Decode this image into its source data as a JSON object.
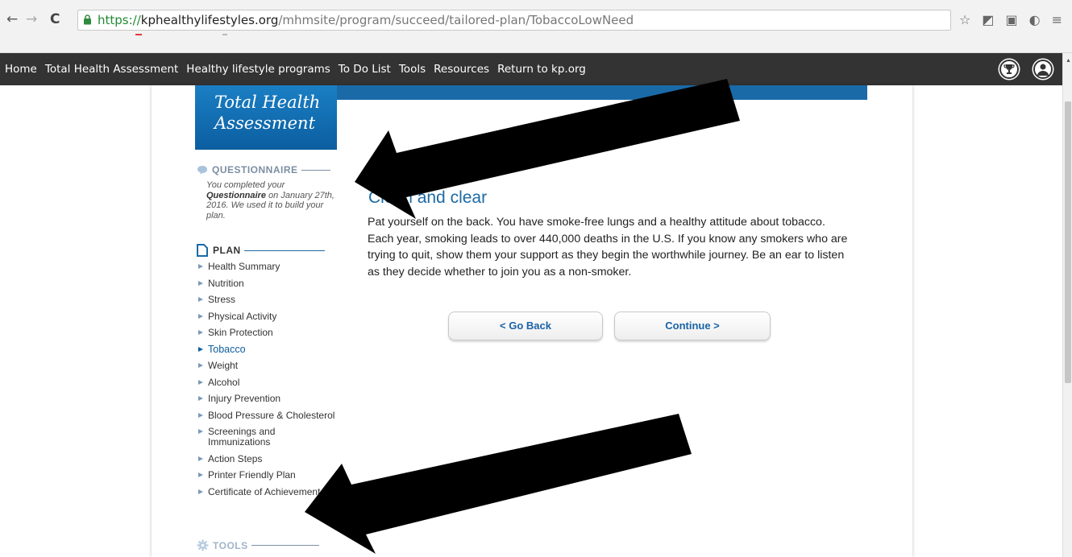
{
  "browser": {
    "url_scheme": "https://",
    "url_host": "kphealthylifestyles.org",
    "url_path": "/mhmsite/program/succeed/tailored-plan/TobaccoLowNeed",
    "back_glyph": "←",
    "forward_glyph": "→",
    "reload_glyph": "C"
  },
  "site_nav": {
    "items": [
      {
        "label": "Home"
      },
      {
        "label": "Total Health Assessment"
      },
      {
        "label": "Healthy lifestyle programs"
      },
      {
        "label": "To Do List"
      },
      {
        "label": "Tools"
      },
      {
        "label": "Resources"
      },
      {
        "label": "Return to kp.org"
      }
    ],
    "right_icons": [
      "trophy-icon",
      "user-icon"
    ]
  },
  "header": {
    "line1": "Total Health",
    "line2": "Assessment",
    "brand_color": "#1b6aa5"
  },
  "sidebar": {
    "questionnaire_heading": "QUESTIONNAIRE",
    "questionnaire_text_1": "You completed your",
    "questionnaire_text_bold": "Questionnaire",
    "questionnaire_text_2": "on January 27th, 2016. We used it to build your plan.",
    "plan_heading": "PLAN",
    "tools_heading": "TOOLS",
    "plan_items": [
      {
        "label": "Health Summary"
      },
      {
        "label": "Nutrition"
      },
      {
        "label": "Stress"
      },
      {
        "label": "Physical Activity"
      },
      {
        "label": "Skin Protection"
      },
      {
        "label": "Tobacco",
        "active": true
      },
      {
        "label": "Weight"
      },
      {
        "label": "Alcohol"
      },
      {
        "label": "Injury Prevention"
      },
      {
        "label": "Blood Pressure & Cholesterol"
      },
      {
        "label": "Screenings and Immunizations"
      },
      {
        "label": "Action Steps"
      },
      {
        "label": "Printer Friendly Plan"
      },
      {
        "label": "Certificate of Achievement"
      }
    ]
  },
  "main": {
    "title": "Clean and clear",
    "body": "Pat yourself on the back. You have smoke-free lungs and a healthy attitude about tobacco. Each year, smoking leads to over 440,000 deaths in the U.S. If you know any smokers who are trying to quit, show them your support as they begin the worthwhile journey. Be an ear to listen as they decide whether to join you as a non-smoker.",
    "back_button": "< Go Back",
    "continue_button": "Continue >"
  }
}
